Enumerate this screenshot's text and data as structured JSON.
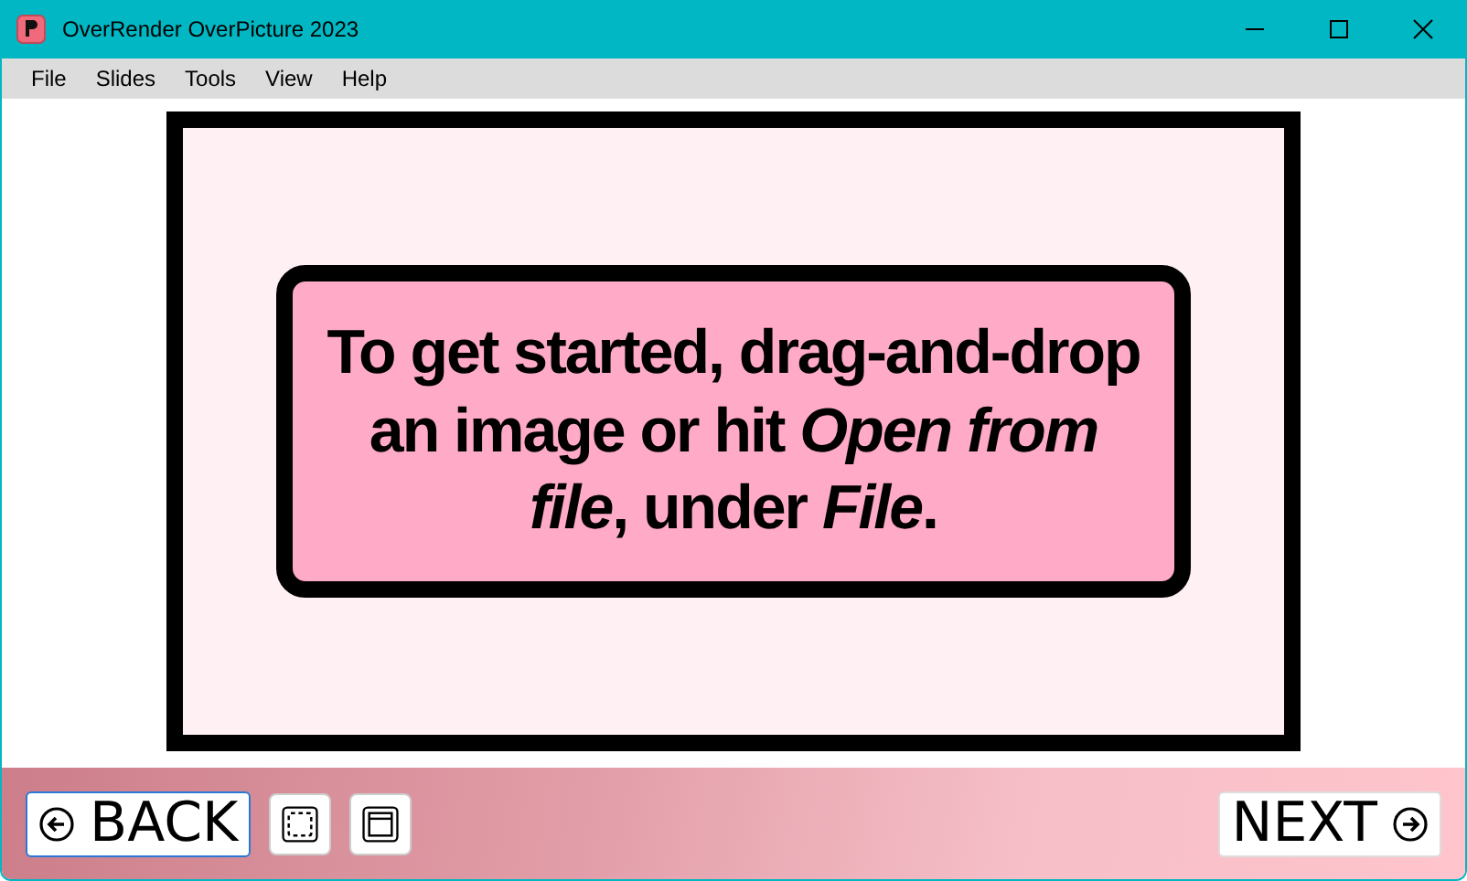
{
  "window": {
    "title": "OverRender OverPicture 2023"
  },
  "menu": [
    "File",
    "Slides",
    "Tools",
    "View",
    "Help"
  ],
  "slide": {
    "message": "To get started, drag-and-drop an image or hit *Open from file*, under *File*."
  },
  "nav": {
    "back": "BACK",
    "next": "NEXT"
  }
}
